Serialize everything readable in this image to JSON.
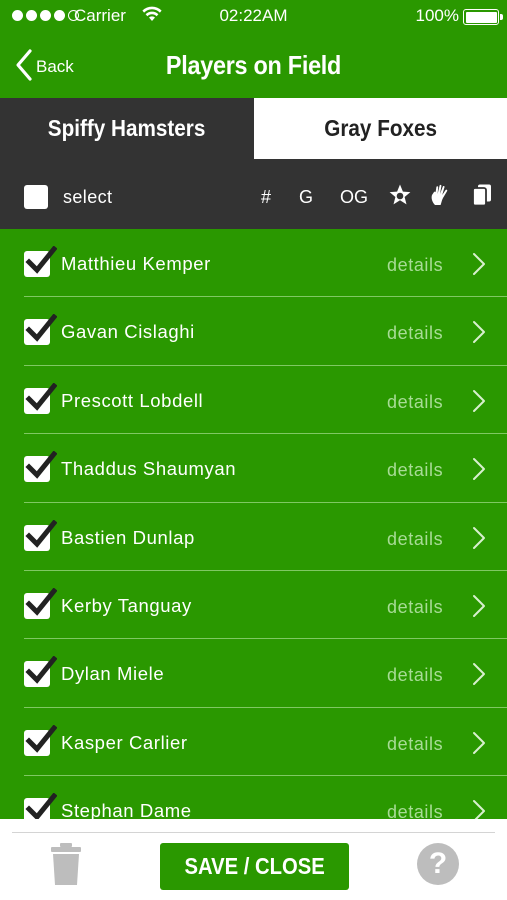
{
  "status_bar": {
    "carrier": "Carrier",
    "time": "02:22AM",
    "battery": "100%",
    "signal_dots_filled": 4,
    "signal_dots_total": 5
  },
  "nav": {
    "back_label": "Back",
    "title": "Players on Field"
  },
  "tabs": [
    {
      "label": "Spiffy Hamsters",
      "active": true
    },
    {
      "label": "Gray Foxes",
      "active": false
    }
  ],
  "header": {
    "select_label": "select",
    "col_number": "#",
    "col_goals": "G",
    "col_own_goals": "OG",
    "icons": [
      "star-icon",
      "hand-icon",
      "cards-icon"
    ]
  },
  "players": [
    {
      "name": "Matthieu Kemper",
      "checked": true,
      "details": "details"
    },
    {
      "name": "Gavan Cislaghi",
      "checked": true,
      "details": "details"
    },
    {
      "name": "Prescott Lobdell",
      "checked": true,
      "details": "details"
    },
    {
      "name": "Thaddus Shaumyan",
      "checked": true,
      "details": "details"
    },
    {
      "name": "Bastien Dunlap",
      "checked": true,
      "details": "details"
    },
    {
      "name": "Kerby Tanguay",
      "checked": true,
      "details": "details"
    },
    {
      "name": "Dylan Miele",
      "checked": true,
      "details": "details"
    },
    {
      "name": "Kasper Carlier",
      "checked": true,
      "details": "details"
    },
    {
      "name": "Stephan Dame",
      "checked": true,
      "details": "details"
    }
  ],
  "footer": {
    "save_label": "SAVE / CLOSE",
    "help_label": "?"
  },
  "colors": {
    "brand_green": "#2a9800",
    "dark_header": "#333333",
    "details_text": "#a8dc96",
    "disabled_grey": "#bdbdbd"
  }
}
